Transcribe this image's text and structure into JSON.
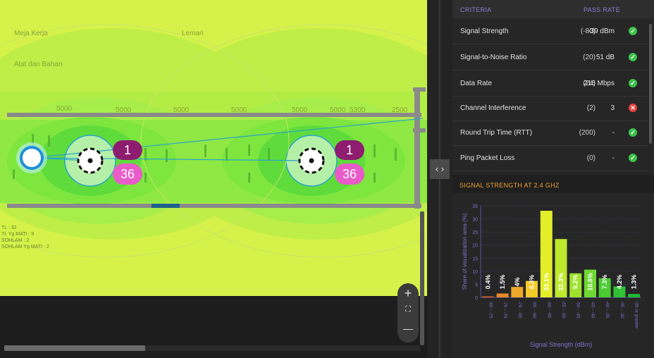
{
  "map": {
    "labels": {
      "top_left": "Meja Kerja",
      "top_mid": "Lemari",
      "second": "Alat dan Bahan"
    },
    "wall_numbers": [
      "5000",
      "5000",
      "5000",
      "5000",
      "5000",
      "5000",
      "5300",
      "2500"
    ],
    "obstacle_lines": "TL : 32\nTL Yg MATI : 9\nSOHLAM : 2\nSOHLAM Yg MATI : 2",
    "access_points": [
      {
        "channel_24": "1",
        "channel_5": "36"
      },
      {
        "channel_24": "1",
        "channel_5": "36"
      }
    ],
    "zoom": {
      "plus": "+",
      "fit": "⛶",
      "minus": "—"
    },
    "collapse_icon": "‹ ›",
    "colors": {
      "base_yellow": "#d6f24a",
      "green_strong": "#57dc3c",
      "green_mid": "#7ee63e",
      "green_light": "#a8ee4a",
      "wall": "#8a8a8a",
      "ap_channel_24": "#8e1d6f",
      "ap_channel_5": "#e85bc8",
      "client": "#1f8fdc"
    }
  },
  "criteria": {
    "header_name": "CRITERIA",
    "header_rate": "PASS RATE",
    "rows": [
      {
        "name": "Signal Strength",
        "required": "(-80)",
        "value": "-39 dBm",
        "status": "pass"
      },
      {
        "name": "Signal-to-Noise Ratio",
        "required": "(20)",
        "value": "51 dB",
        "status": "pass"
      },
      {
        "name": "Data Rate",
        "required": "(24)",
        "value": "216 Mbps",
        "status": "pass"
      },
      {
        "name": "Channel Interference",
        "required": "(2)",
        "value": "3",
        "status": "fail"
      },
      {
        "name": "Round Trip Time (RTT)",
        "required": "(200)",
        "value": "-",
        "status": "pass"
      },
      {
        "name": "Ping Packet Loss",
        "required": "(0)",
        "value": "-",
        "status": "pass"
      }
    ],
    "pass_icon": "✓",
    "fail_icon": "✕"
  },
  "signal_section": {
    "title": "SIGNAL STRENGTH AT 2.4 GHZ"
  },
  "chart_data": {
    "type": "bar",
    "title": "",
    "xlabel": "Signal Strength (dBm)",
    "ylabel": "Share of visualization area (%)",
    "ylim": [
      0,
      35
    ],
    "yticks": [
      0,
      5,
      10,
      15,
      20,
      25,
      30,
      35
    ],
    "grid": true,
    "categories": [
      "-80 - -75",
      "-75 - -70",
      "-70 - -65",
      "-65 - -60",
      "-60 - -55",
      "-55 - -50",
      "-50 - -45",
      "-45 - -40",
      "-40 - -35",
      "-35 - -30",
      "-30 or greater"
    ],
    "values": [
      0.4,
      1.5,
      4,
      6.3,
      33.1,
      22.3,
      9.2,
      10.6,
      7.3,
      4.2,
      1.3
    ],
    "value_labels": [
      "0.4%",
      "1.5%",
      "4%",
      "6.3%",
      "33.1%",
      "22.3%",
      "9.2%",
      "10.6%",
      "7.3%",
      "4.2%",
      "1.3%"
    ],
    "bar_colors": [
      "#e0602a",
      "#e58a28",
      "#eca82a",
      "#f3cc2a",
      "#e2ee28",
      "#bde82c",
      "#9fe22e",
      "#6ed832",
      "#4acb32",
      "#30c234",
      "#20bb36"
    ]
  }
}
